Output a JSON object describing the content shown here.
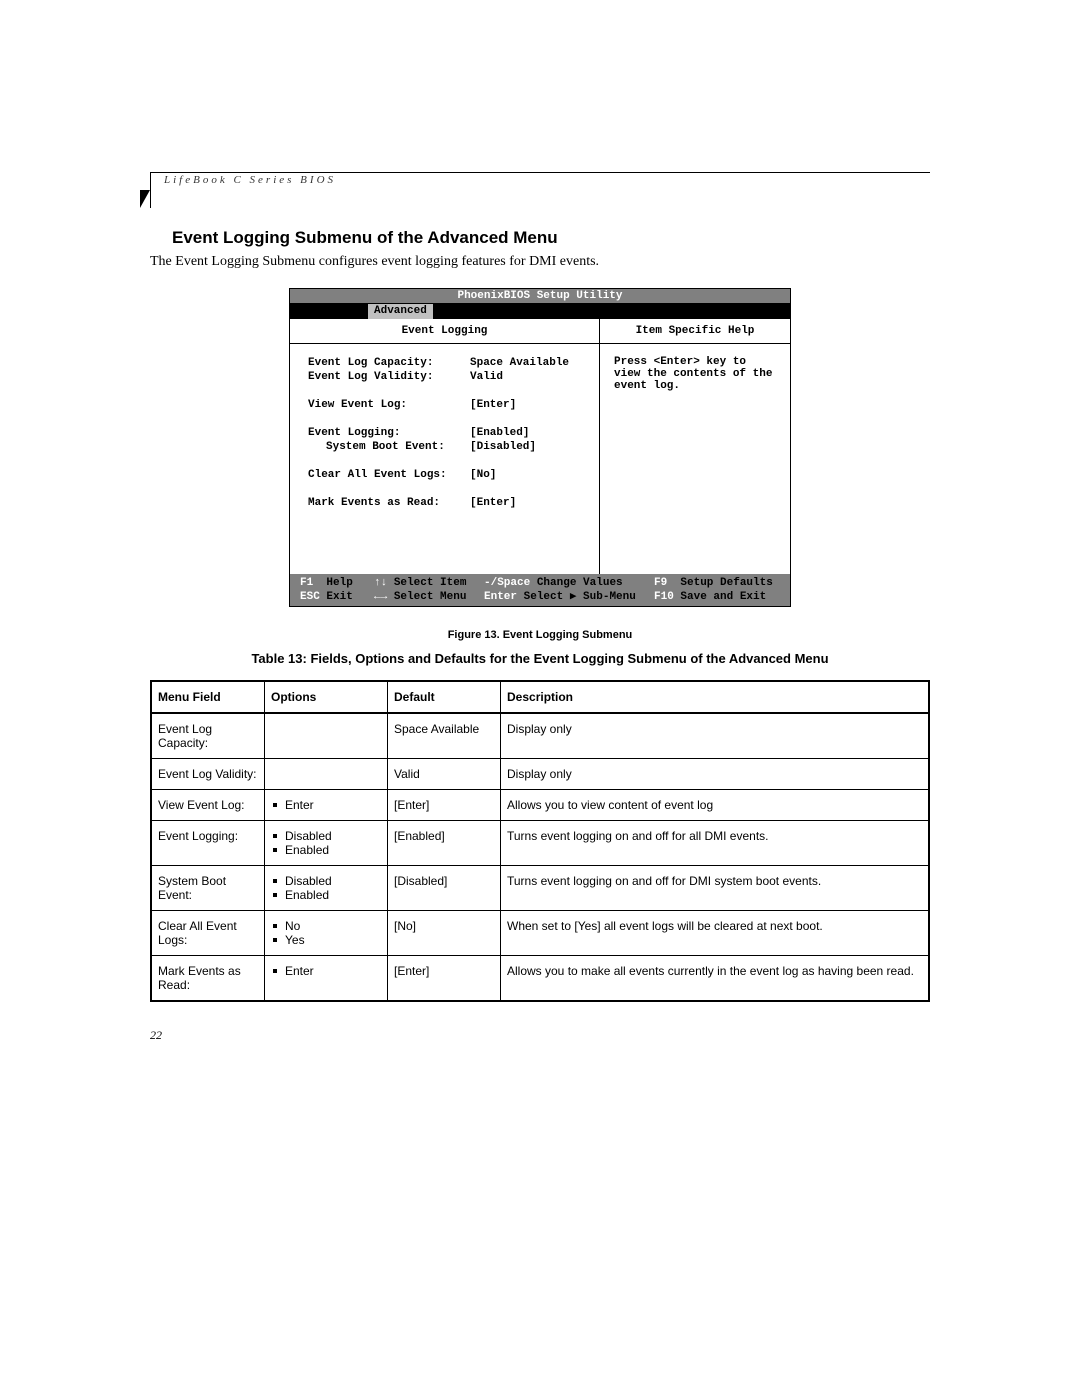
{
  "running_head": "LifeBook C Series BIOS",
  "heading": "Event Logging Submenu of the Advanced Menu",
  "intro": "The Event Logging Submenu configures event logging features for DMI events.",
  "bios": {
    "title": "PhoenixBIOS Setup Utility",
    "active_tab": "Advanced",
    "left_header": "Event Logging",
    "right_header": "Item Specific Help",
    "rows": [
      {
        "label": "Event Log Capacity:",
        "value": "Space Available"
      },
      {
        "label": "Event Log Validity:",
        "value": "Valid"
      },
      {
        "gap": true
      },
      {
        "label": "View Event Log:",
        "value": "[Enter]"
      },
      {
        "gap": true
      },
      {
        "label": "Event Logging:",
        "value": "[Enabled]"
      },
      {
        "label": "System Boot Event:",
        "value": "[Disabled]",
        "indent": true
      },
      {
        "gap": true
      },
      {
        "label": "Clear All Event Logs:",
        "value": "[No]"
      },
      {
        "gap": true
      },
      {
        "label": "Mark Events as Read:",
        "value": "[Enter]"
      }
    ],
    "help_text": "Press <Enter> key to view the contents of the event log.",
    "footer": {
      "r1": {
        "c1a": "F1",
        "c1b": "Help",
        "c2a": "↑↓",
        "c2b": "Select Item",
        "c3a": "-/Space",
        "c3b": "Change Values",
        "c4a": "F9",
        "c4b": "Setup Defaults"
      },
      "r2": {
        "c1a": "ESC",
        "c1b": "Exit",
        "c2a": "←→",
        "c2b": "Select Menu",
        "c3a": "Enter",
        "c3b": "Select ▶ Sub-Menu",
        "c4a": "F10",
        "c4b": "Save and Exit"
      }
    }
  },
  "figure_caption": "Figure 13.  Event Logging Submenu",
  "table_title": "Table 13: Fields, Options and Defaults for the Event Logging Submenu of the Advanced Menu",
  "table": {
    "headers": [
      "Menu Field",
      "Options",
      "Default",
      "Description"
    ],
    "rows": [
      {
        "field": "Event Log Capacity:",
        "options": [],
        "default": "Space Available",
        "desc": "Display only"
      },
      {
        "field": "Event Log Validity:",
        "options": [],
        "default": "Valid",
        "desc": "Display only"
      },
      {
        "field": "View Event Log:",
        "options": [
          "Enter"
        ],
        "default": "[Enter]",
        "desc": "Allows you to view content of event log"
      },
      {
        "field": "Event Logging:",
        "options": [
          "Disabled",
          "Enabled"
        ],
        "default": "[Enabled]",
        "desc": "Turns event logging on and off for all DMI events."
      },
      {
        "field": "System Boot Event:",
        "options": [
          "Disabled",
          "Enabled"
        ],
        "default": "[Disabled]",
        "desc": "Turns event logging on and off for DMI system boot events.",
        "sub": true
      },
      {
        "field": "Clear All Event Logs:",
        "options": [
          "No",
          "Yes"
        ],
        "default": "[No]",
        "desc": "When set to [Yes] all event logs will be cleared at next boot."
      },
      {
        "field": "Mark Events as Read:",
        "options": [
          "Enter"
        ],
        "default": "[Enter]",
        "desc": "Allows you to make all events currently in the event log as having been read."
      }
    ]
  },
  "page_number": "22"
}
